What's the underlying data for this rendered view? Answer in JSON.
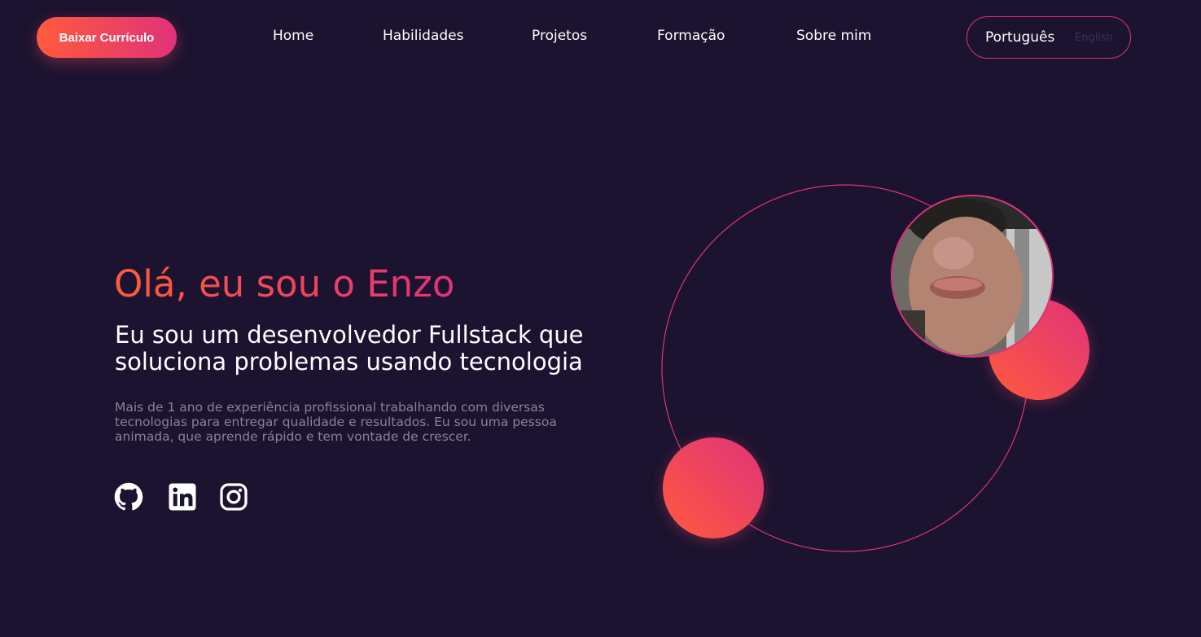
{
  "header": {
    "cv_button_label": "Baixar Currículo",
    "nav": [
      "Home",
      "Habilidades",
      "Projetos",
      "Formação",
      "Sobre mim"
    ],
    "language": {
      "active": "Português",
      "inactive": "English"
    }
  },
  "hero": {
    "greeting": "Olá, eu sou o Enzo",
    "title": "Eu sou um desenvolvedor Fullstack que soluciona problemas usando tecnologia",
    "description": "Mais de 1 ano de experiência profissional trabalhando com diversas tecnologias para entregar qualidade e resultados. Eu sou uma pessoa animada, que aprende rápido e tem vontade de crescer."
  },
  "socials": [
    {
      "icon": "github-icon"
    },
    {
      "icon": "linkedin-icon"
    },
    {
      "icon": "instagram-icon"
    }
  ],
  "colors": {
    "background": "#1b1330",
    "accent_start": "#ff5a3c",
    "accent_end": "#e0327a"
  }
}
